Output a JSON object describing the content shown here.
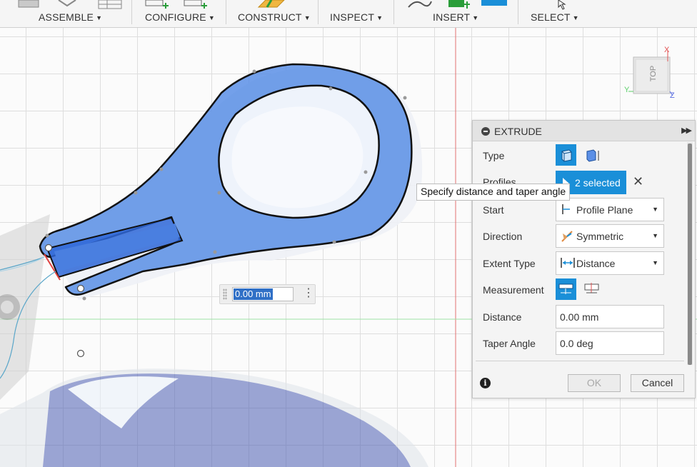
{
  "toolbar": {
    "groups": [
      {
        "label": "ASSEMBLE"
      },
      {
        "label": "CONFIGURE"
      },
      {
        "label": "CONSTRUCT"
      },
      {
        "label": "INSPECT"
      },
      {
        "label": "INSERT"
      },
      {
        "label": "SELECT"
      }
    ]
  },
  "viewcube": {
    "face": "TOP",
    "axis_x": "X",
    "axis_y": "Y",
    "axis_z": "Z"
  },
  "dimension_input": {
    "value": "0.00 mm"
  },
  "tooltip": "Specify distance and taper angle",
  "panel": {
    "title": "EXTRUDE",
    "rows": {
      "type": {
        "label": "Type"
      },
      "profiles": {
        "label": "Profiles",
        "value": "2 selected"
      },
      "start": {
        "label": "Start",
        "value": "Profile Plane"
      },
      "direction": {
        "label": "Direction",
        "value": "Symmetric"
      },
      "extent_type": {
        "label": "Extent Type",
        "value": "Distance"
      },
      "measurement": {
        "label": "Measurement"
      },
      "distance": {
        "label": "Distance",
        "value": "0.00 mm"
      },
      "taper_angle": {
        "label": "Taper Angle",
        "value": "0.0 deg"
      }
    },
    "ok_label": "OK",
    "cancel_label": "Cancel"
  },
  "colors": {
    "accent": "#1a8fd8",
    "profile_fill": "#5b8fe6",
    "x_axis": "#e05050",
    "y_axis": "#5ccf6a",
    "z_axis": "#5b6fe0"
  }
}
